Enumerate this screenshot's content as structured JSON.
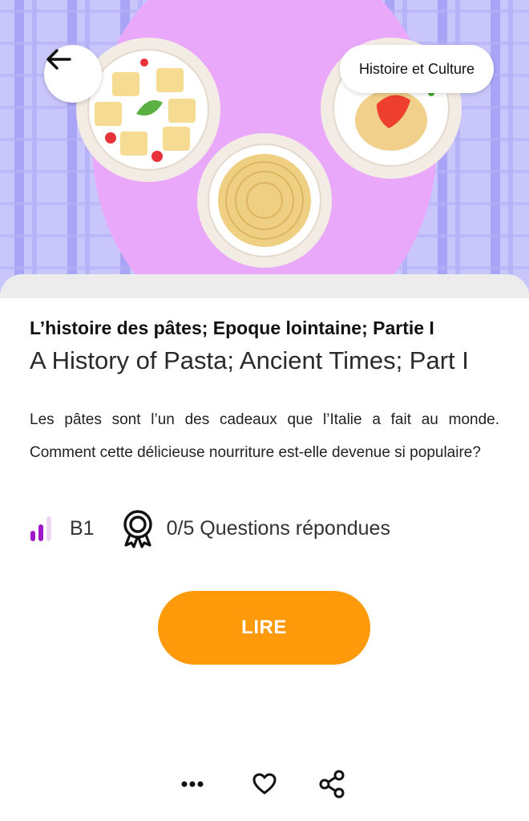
{
  "hero": {
    "category_label": "Histoire et Culture",
    "colors": {
      "background": "#c9c6fb",
      "stripes": "#a9a4f6",
      "circle": "#eaa8fb"
    },
    "icons": {
      "back": "arrow-left-icon"
    }
  },
  "article": {
    "title_fr": "L’histoire des pâtes; Epoque lointaine; Partie I",
    "title_en": "A History of Pasta; Ancient Times; Part I",
    "description": "Les pâtes sont l’un des cadeaux que l’Italie a fait au monde. Comment cette délicieuse nourriture est-elle devenue si populaire?",
    "level": "B1",
    "questions_status": "0/5 Questions répondues",
    "icons": {
      "level": "level-bars-icon",
      "questions": "ribbon-award-icon"
    },
    "level_color": "#a016c9"
  },
  "actions": {
    "read_label": "LIRE",
    "read_color": "#ff9a0a",
    "bottom_icons": [
      "more-icon",
      "heart-icon",
      "share-icon"
    ]
  }
}
